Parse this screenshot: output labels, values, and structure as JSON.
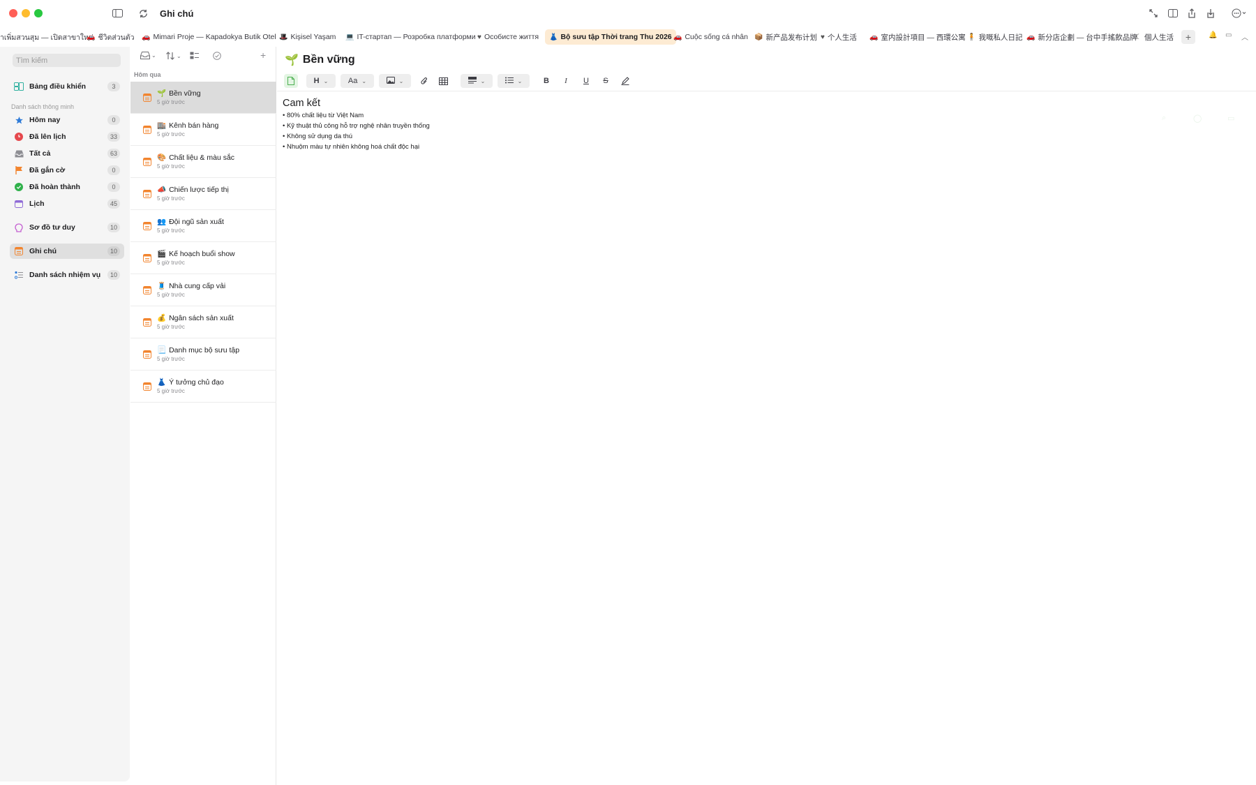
{
  "window": {
    "title": "Ghi chú"
  },
  "tabs": [
    {
      "label": "าเพิ่มสวนสุม — เปิดสาขาใหม่",
      "icon": "none"
    },
    {
      "label": "ชีวิตส่วนตัว",
      "icon": "car-icon"
    },
    {
      "label": "Mimari Proje — Kapadokya Butik Otel",
      "icon": "car-icon"
    },
    {
      "label": "Kişisel Yaşam",
      "icon": "hat-icon"
    },
    {
      "label": "IT-стартап — Розробка платформи",
      "icon": "laptop-icon"
    },
    {
      "label": "Особисте життя",
      "icon": "heart-icon"
    },
    {
      "label": "Bộ sưu tập Thời trang Thu 2026",
      "icon": "dress-icon",
      "active": true
    },
    {
      "label": "Cuộc sống cá nhân",
      "icon": "car-icon"
    },
    {
      "label": "新产品发布计划",
      "icon": "box-icon"
    },
    {
      "label": "个人生活",
      "icon": "heart-icon"
    },
    {
      "label": "室内設計項目 — 西環公寓",
      "icon": "car-icon"
    },
    {
      "label": "我嘅私人日記",
      "icon": "person-icon"
    },
    {
      "label": "新分店企劃 — 台中手搖飲品牌",
      "icon": "car-icon"
    },
    {
      "label": "個人生活",
      "icon": "moon-icon"
    }
  ],
  "sidebar": {
    "search_placeholder": "Tìm kiếm",
    "dashboard": {
      "label": "Bảng điều khiển",
      "count": "3"
    },
    "smart_list_heading": "Danh sách thông minh",
    "smart_items": [
      {
        "label": "Hôm nay",
        "count": "0",
        "icon": "star-icon",
        "color": "#2f7bd8"
      },
      {
        "label": "Đã lên lịch",
        "count": "33",
        "icon": "clock-icon",
        "color": "#e5484d"
      },
      {
        "label": "Tất cả",
        "count": "63",
        "icon": "tray-icon",
        "color": "#8e8e93"
      },
      {
        "label": "Đã gắn cờ",
        "count": "0",
        "icon": "flag-icon",
        "color": "#f2842e"
      },
      {
        "label": "Đã hoàn thành",
        "count": "0",
        "icon": "check-circle-icon",
        "color": "#30b14b"
      },
      {
        "label": "Lịch",
        "count": "45",
        "icon": "calendar-icon",
        "color": "#8f6ad6"
      }
    ],
    "mindmap": {
      "label": "Sơ đồ tư duy",
      "count": "10",
      "icon": "brain-icon",
      "color": "#c45fd1"
    },
    "notes": {
      "label": "Ghi chú",
      "count": "10",
      "icon": "note-icon",
      "color": "#f2842e"
    },
    "tasks": {
      "label": "Danh sách nhiệm vụ",
      "count": "10",
      "icon": "checklist-icon",
      "color": "#2f7bd8"
    }
  },
  "note_list": {
    "group_label": "Hôm qua",
    "notes": [
      {
        "emoji": "🌱",
        "title": "Bền vững",
        "time": "5 giờ trước",
        "active": true
      },
      {
        "emoji": "🏬",
        "title": "Kênh bán hàng",
        "time": "5 giờ trước"
      },
      {
        "emoji": "🎨",
        "title": "Chất liệu & màu sắc",
        "time": "5 giờ trước"
      },
      {
        "emoji": "📣",
        "title": "Chiến lược tiếp thị",
        "time": "5 giờ trước"
      },
      {
        "emoji": "👥",
        "title": "Đội ngũ sản xuất",
        "time": "5 giờ trước"
      },
      {
        "emoji": "🎬",
        "title": "Kế hoạch buổi show",
        "time": "5 giờ trước"
      },
      {
        "emoji": "🧵",
        "title": "Nhà cung cấp vải",
        "time": "5 giờ trước"
      },
      {
        "emoji": "💰",
        "title": "Ngân sách sản xuất",
        "time": "5 giờ trước"
      },
      {
        "emoji": "📃",
        "title": "Danh mục bộ sưu tập",
        "time": "5 giờ trước"
      },
      {
        "emoji": "👗",
        "title": "Ý tưởng chủ đạo",
        "time": "5 giờ trước"
      }
    ]
  },
  "editor": {
    "title_emoji": "🌱",
    "title": "Bền vững",
    "toolbar": {
      "heading": "H",
      "font": "Aa",
      "bold": "B",
      "italic": "I",
      "underline": "U",
      "strike": "S"
    },
    "heading": "Cam kết",
    "bullets": [
      "• 80% chất liệu từ Việt Nam",
      "• Kỹ thuật thủ công hỗ trợ nghệ nhân truyền thống",
      "• Không sử dụng da thú",
      "• Nhuộm màu tự nhiên không hoá chất độc hại"
    ]
  },
  "colors": {
    "accent_tab": "#fdebd3",
    "selected_row": "#dcdcdc"
  }
}
